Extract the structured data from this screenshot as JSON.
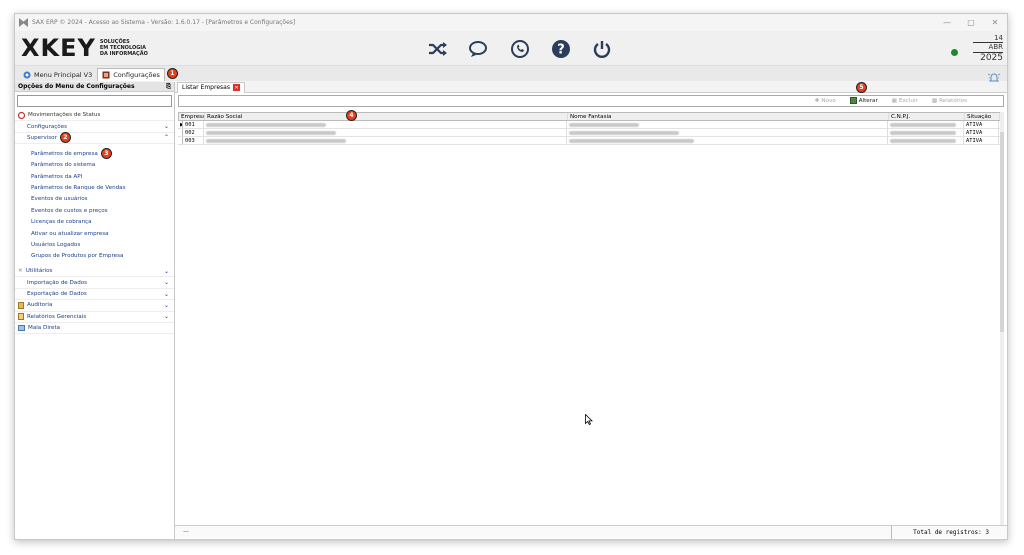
{
  "window": {
    "title": "SAX ERP © 2024 - Acesso ao Sistema - Versão: 1.6.0.17 - [Parâmetros e Configurações]"
  },
  "header": {
    "logo_text": "XKEY",
    "logo_sub_1": "SOLUÇÕES",
    "logo_sub_2": "EM TECNOLOGIA",
    "logo_sub_3": "DA INFORMAÇÃO",
    "date_day": "14",
    "date_month": "ABR",
    "date_year": "2025",
    "status_color": "#1f8a2a"
  },
  "app_tabs": [
    {
      "label": "Menu Principal V3",
      "icon": "menu-icon"
    },
    {
      "label": "Configurações",
      "icon": "settings-icon",
      "badge": "1"
    }
  ],
  "sidebar": {
    "title": "Opções do Menu de Configurações",
    "items": [
      {
        "label": "Movimentações de Status"
      },
      {
        "label": "Configurações"
      },
      {
        "label": "Supervisor",
        "badge": "2"
      }
    ],
    "supervisor_children": [
      {
        "label": "Parâmetros de empresa",
        "badge": "3"
      },
      {
        "label": "Parâmetros do sistema"
      },
      {
        "label": "Parâmetros da API"
      },
      {
        "label": "Parâmetros de Ranque de Vendas"
      },
      {
        "label": "Eventos de usuários"
      },
      {
        "label": "Eventos de custos e preços"
      },
      {
        "label": "Licenças de cobrança"
      },
      {
        "label": "Ativar ou atualizar empresa"
      },
      {
        "label": "Usuários Logados"
      },
      {
        "label": "Grupos de Produtos por Empresa"
      }
    ],
    "bottom_items": [
      {
        "label": "Utilitários"
      },
      {
        "label": "Importação de Dados"
      },
      {
        "label": "Exportação de Dados"
      },
      {
        "label": "Auditoria"
      },
      {
        "label": "Relatórios Gerenciais"
      },
      {
        "label": "Mala Direta"
      }
    ]
  },
  "main": {
    "doc_tab": "Listar Empresas",
    "actions_badge": "5",
    "grid_badge": "4",
    "actions": [
      {
        "label": "Novo",
        "enabled": false
      },
      {
        "label": "Alterar",
        "enabled": true
      },
      {
        "label": "Excluir",
        "enabled": false
      },
      {
        "label": "Relatórios",
        "enabled": false
      }
    ],
    "columns": [
      "Empresa",
      "Razão Social",
      "Nome Fantasia",
      "C.N.P.J.",
      "Situação"
    ],
    "rows": [
      {
        "empresa": "001",
        "situacao": "ATIVA"
      },
      {
        "empresa": "002",
        "situacao": "ATIVA"
      },
      {
        "empresa": "003",
        "situacao": "ATIVA"
      }
    ],
    "footer_dash": "—",
    "total": "Total de registros: 3"
  }
}
